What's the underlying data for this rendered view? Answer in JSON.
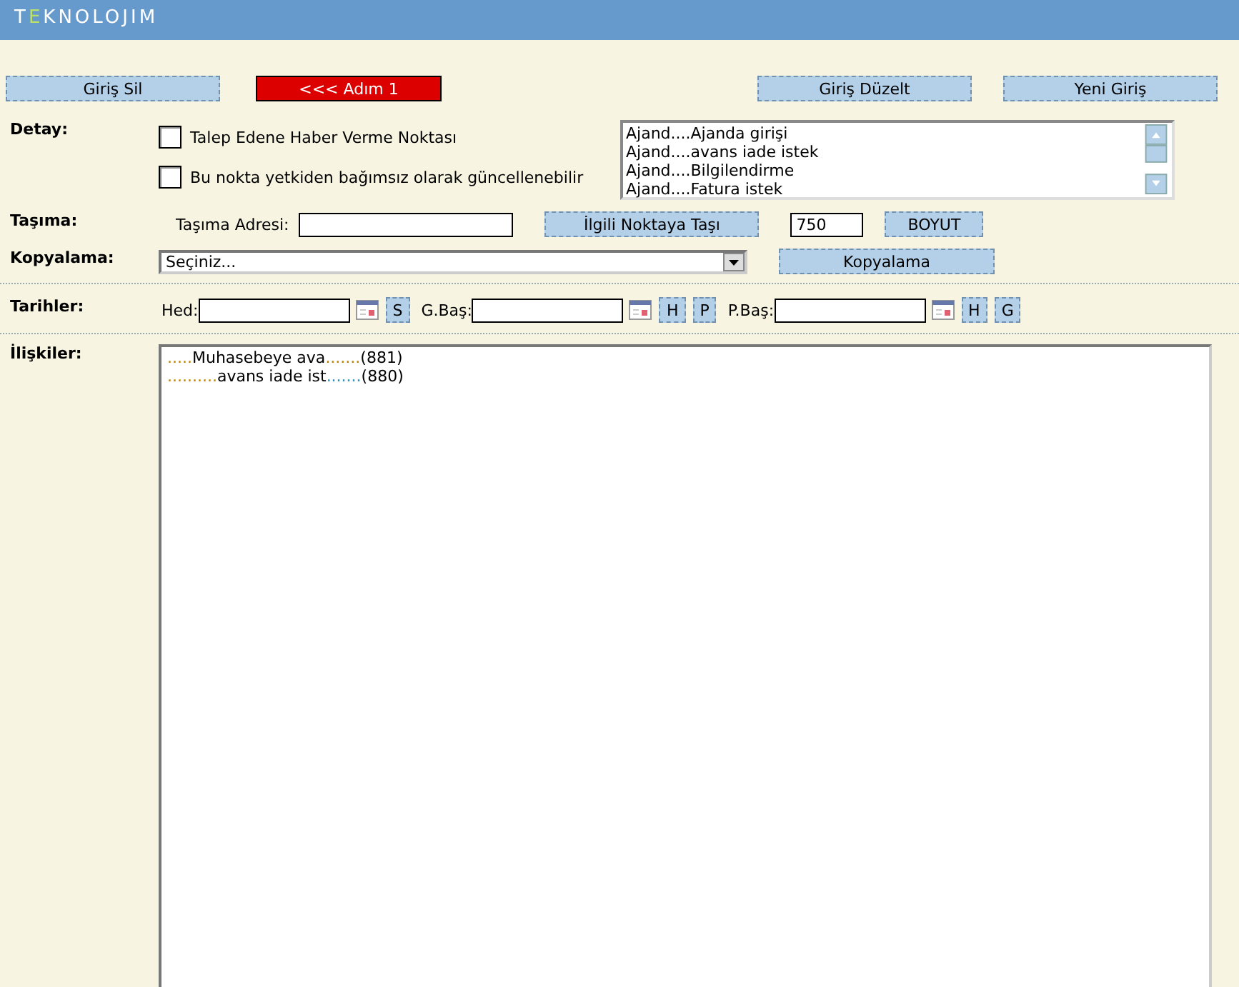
{
  "header": {
    "logo": [
      {
        "text": "T",
        "accent": false
      },
      {
        "text": "E",
        "accent": true
      },
      {
        "text": "KNOLOJIM",
        "accent": false
      }
    ]
  },
  "top_buttons": [
    {
      "label": "Giriş Sil",
      "kind": "action"
    },
    {
      "label": "<<< Adım 1",
      "kind": "step"
    },
    {
      "label": "Giriş Düzelt",
      "kind": "action"
    },
    {
      "label": "Yeni Giriş",
      "kind": "action"
    }
  ],
  "detay": {
    "label": "Detay:",
    "checkboxes": [
      {
        "label": "Talep Edene Haber Verme Noktası",
        "checked": false
      },
      {
        "label": "Bu nokta yetkiden bağımsız olarak güncellenebilir",
        "checked": false
      }
    ],
    "list": [
      {
        "prefix": "Ajand....",
        "text": "Ajanda girişi"
      },
      {
        "prefix": "Ajand....",
        "text": "avans iade istek"
      },
      {
        "prefix": "Ajand....",
        "text": "Bilgilendirme"
      },
      {
        "prefix": "Ajand....",
        "text": "Fatura istek"
      }
    ]
  },
  "tasima": {
    "label": "Taşıma:",
    "address_label": "Taşıma Adresi:",
    "move_button": "İlgili Noktaya Taşı",
    "size_value": "750",
    "size_button": "BOYUT"
  },
  "kopyalama": {
    "label": "Kopyalama:",
    "select_value": "Seçiniz...",
    "button": "Kopyalama"
  },
  "tarihler": {
    "label": "Tarihler:",
    "fields": [
      {
        "label": "Hed:",
        "buttons": [
          "S"
        ]
      },
      {
        "label": "G.Baş:",
        "buttons": [
          "H",
          "P"
        ]
      },
      {
        "label": "P.Baş:",
        "buttons": [
          "H",
          "G"
        ]
      }
    ]
  },
  "iliskiler": {
    "label": "İlişkiler:",
    "lines": [
      {
        "parts": [
          {
            "text": ".....",
            "color": "#c08000"
          },
          {
            "text": "Muhasebeye ava"
          },
          {
            "text": ".......",
            "color": "#c08000"
          },
          {
            "text": "(881)"
          }
        ]
      },
      {
        "parts": [
          {
            "text": "..........",
            "color": "#c08000"
          },
          {
            "text": "avans iade ist"
          },
          {
            "text": ".......",
            "color": "#2a8fc0"
          },
          {
            "text": "(880)"
          }
        ]
      }
    ]
  }
}
